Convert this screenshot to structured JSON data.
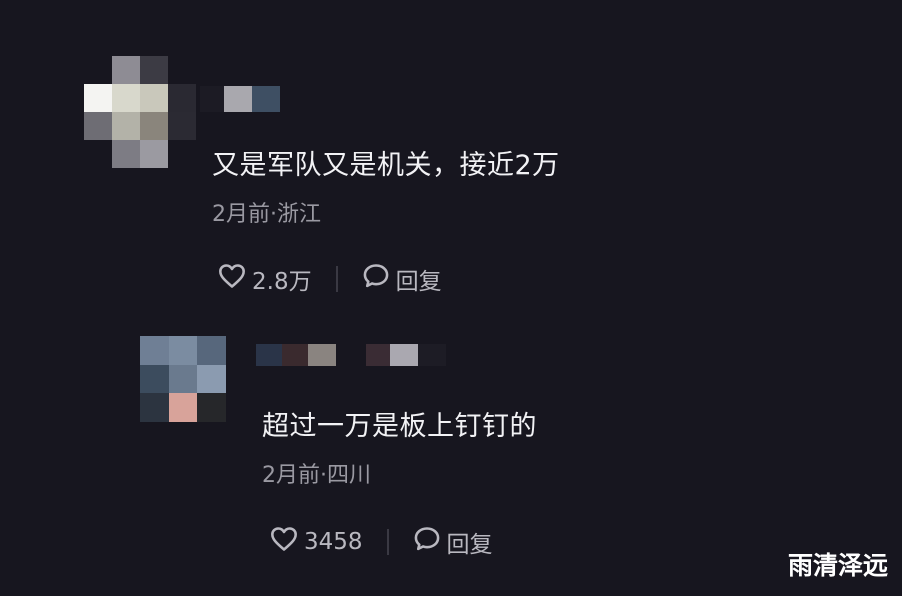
{
  "comments": [
    {
      "text": "又是军队又是机关，接近2万",
      "meta": "2月前·浙江",
      "likes": "2.8万",
      "reply_label": "回复",
      "avatar_icon": "blurred-avatar"
    },
    {
      "text": "超过一万是板上钉钉的",
      "meta": "2月前·四川",
      "likes": "3458",
      "reply_label": "回复",
      "avatar_icon": "blurred-avatar"
    }
  ],
  "watermark": "雨清泽远",
  "colors": {
    "background": "#17161f",
    "text": "#f2f2f5",
    "meta": "#9a99a2",
    "action": "#b9b8c0"
  }
}
